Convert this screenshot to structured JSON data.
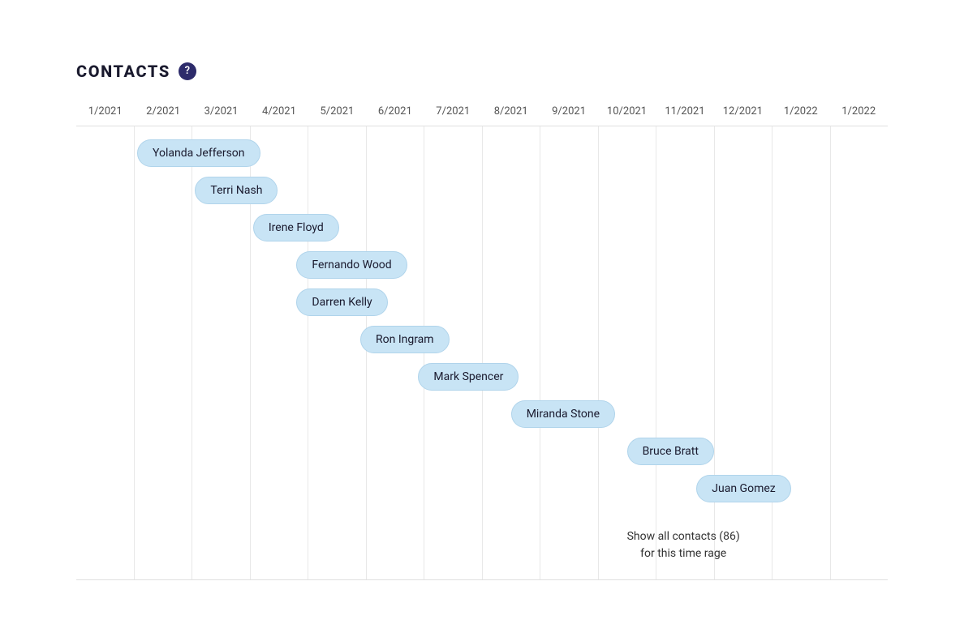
{
  "header": {
    "title": "CONTACTS",
    "help_icon": "?"
  },
  "timeline": {
    "columns": [
      "1/2021",
      "2/2021",
      "3/2021",
      "4/2021",
      "5/2021",
      "6/2021",
      "7/2021",
      "8/2021",
      "9/2021",
      "10/2021",
      "11/2021",
      "12/2021",
      "1/2022",
      "1/2022"
    ]
  },
  "contacts": [
    {
      "name": "Yolanda Jefferson",
      "col": 1,
      "row": 1
    },
    {
      "name": "Terri Nash",
      "col": 2,
      "row": 2
    },
    {
      "name": "Irene Floyd",
      "col": 3,
      "row": 3
    },
    {
      "name": "Fernando Wood",
      "col": 4,
      "row": 4
    },
    {
      "name": "Darren Kelly",
      "col": 4,
      "row": 5
    },
    {
      "name": "Ron Ingram",
      "col": 5,
      "row": 6
    },
    {
      "name": "Mark Spencer",
      "col": 6,
      "row": 7
    },
    {
      "name": "Miranda Stone",
      "col": 8,
      "row": 8
    },
    {
      "name": "Bruce Bratt",
      "col": 10,
      "row": 9
    },
    {
      "name": "Juan Gomez",
      "col": 11,
      "row": 10
    }
  ],
  "show_all": {
    "label": "Show all contacts (86)",
    "sublabel": "for this time rage"
  }
}
